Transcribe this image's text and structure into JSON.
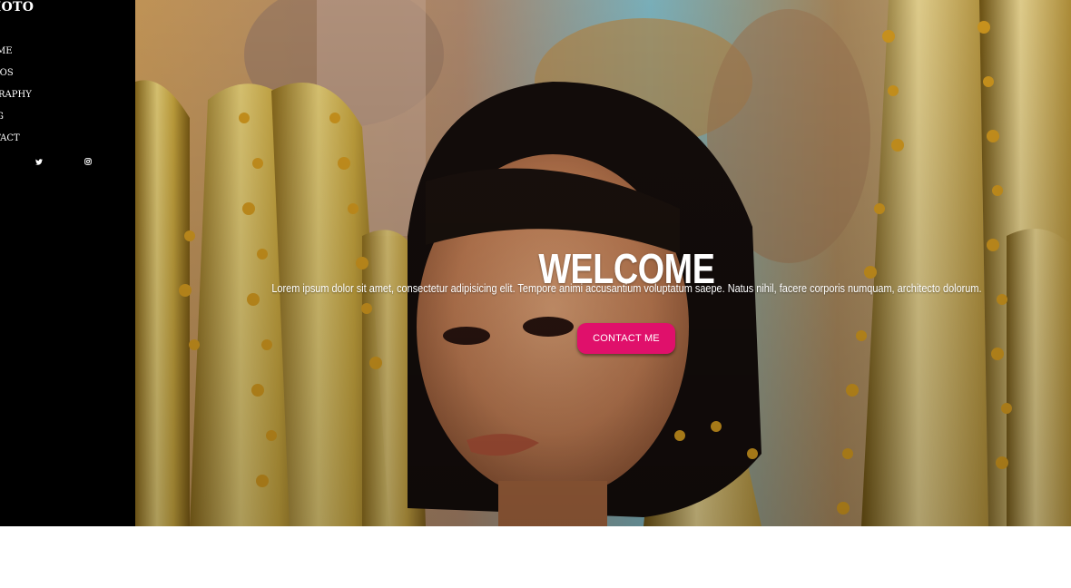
{
  "brand": {
    "text": "HOTO"
  },
  "nav": {
    "items": [
      {
        "label": "ME"
      },
      {
        "label": "TOS"
      },
      {
        "label": "GRAPHY"
      },
      {
        "label": "G"
      },
      {
        "label": "TACT"
      }
    ]
  },
  "social": {
    "icons": [
      "twitter-icon",
      "instagram-icon"
    ]
  },
  "hero": {
    "title": "WELCOME",
    "subtitle": "Lorem ipsum dolor sit amet, consectetur adipisicing elit. Tempore animi accusantium voluptatum saepe. Natus nihil, facere corporis numquam, architecto dolorum.",
    "cta_label": "CONTACT ME",
    "image": "hero-photo"
  },
  "colors": {
    "sidebar_bg": "#000000",
    "cta_bg": "#e0106b",
    "text": "#ffffff",
    "page_bg": "#ffffff"
  }
}
